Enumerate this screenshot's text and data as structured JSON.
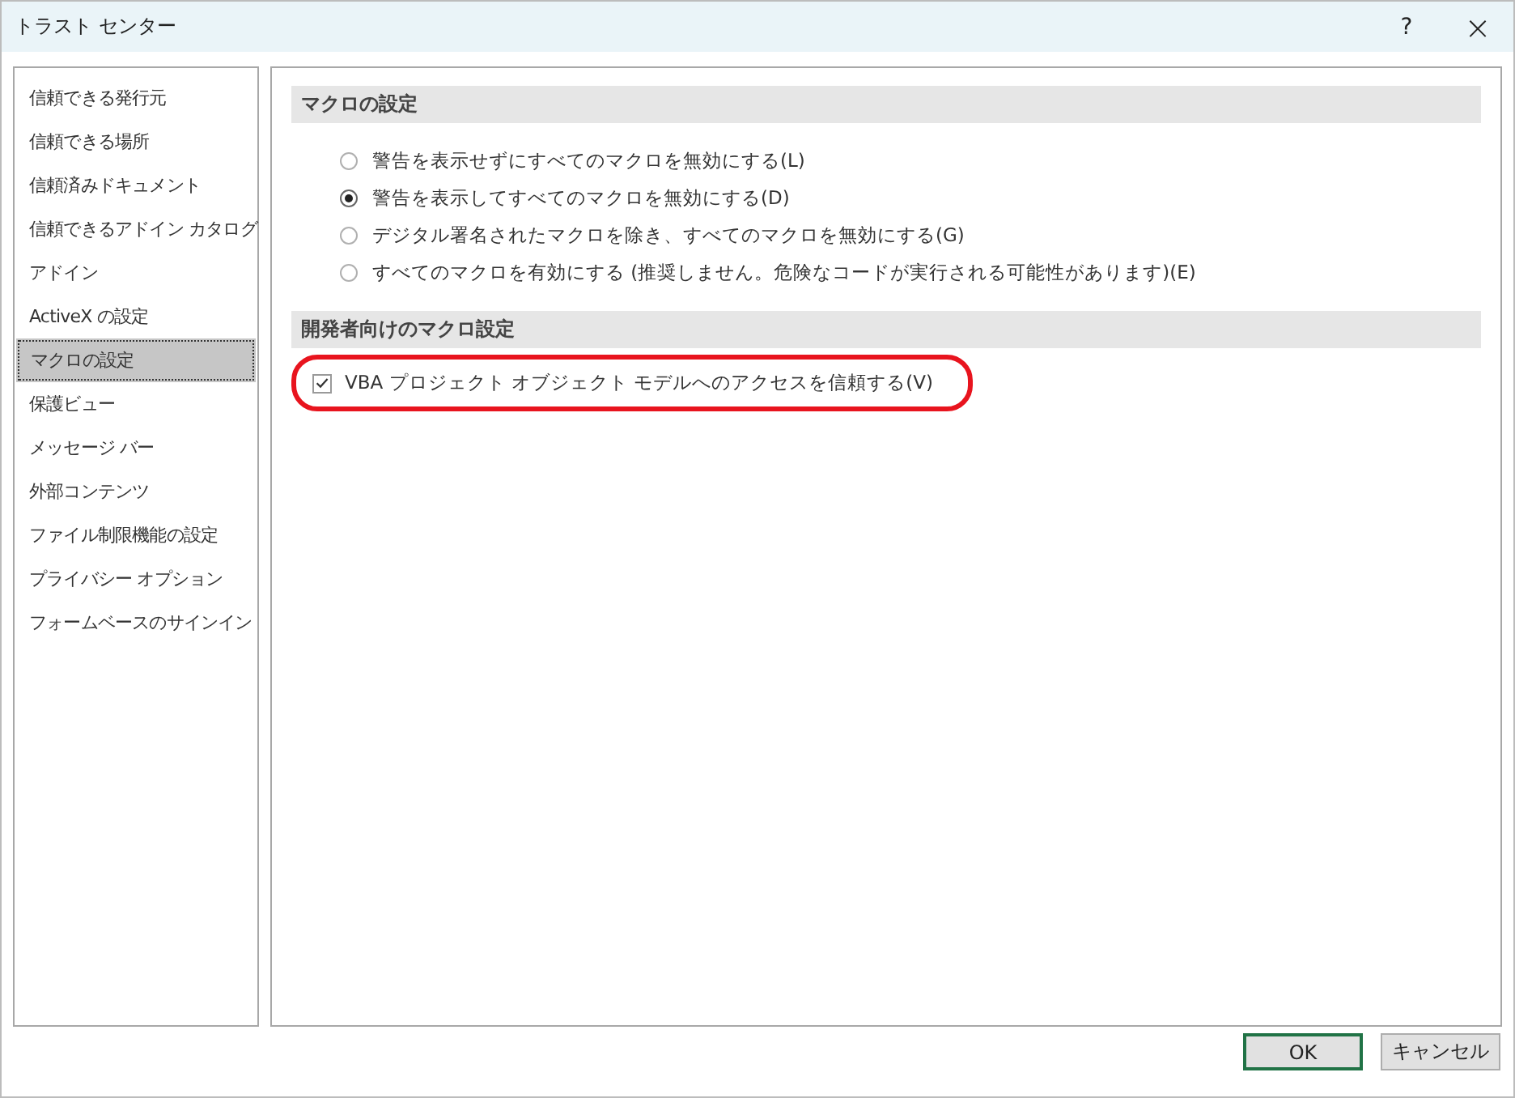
{
  "window": {
    "title": "トラスト センター",
    "help": "?",
    "close": "×"
  },
  "sidebar": {
    "items": [
      {
        "label": "信頼できる発行元",
        "selected": false
      },
      {
        "label": "信頼できる場所",
        "selected": false
      },
      {
        "label": "信頼済みドキュメント",
        "selected": false
      },
      {
        "label": "信頼できるアドイン カタログ",
        "selected": false
      },
      {
        "label": "アドイン",
        "selected": false
      },
      {
        "label": "ActiveX の設定",
        "selected": false
      },
      {
        "label": "マクロの設定",
        "selected": true
      },
      {
        "label": "保護ビュー",
        "selected": false
      },
      {
        "label": "メッセージ バー",
        "selected": false
      },
      {
        "label": "外部コンテンツ",
        "selected": false
      },
      {
        "label": "ファイル制限機能の設定",
        "selected": false
      },
      {
        "label": "プライバシー オプション",
        "selected": false
      },
      {
        "label": "フォームベースのサインイン",
        "selected": false
      }
    ]
  },
  "sections": [
    {
      "title": "マクロの設定",
      "kind": "radio",
      "options": [
        {
          "label": "警告を表示せずにすべてのマクロを無効にする(L)",
          "selected": false
        },
        {
          "label": "警告を表示してすべてのマクロを無効にする(D)",
          "selected": true
        },
        {
          "label": "デジタル署名されたマクロを除き、すべてのマクロを無効にする(G)",
          "selected": false
        },
        {
          "label": "すべてのマクロを有効にする (推奨しません。危険なコードが実行される可能性があります)(E)",
          "selected": false
        }
      ]
    },
    {
      "title": "開発者向けのマクロ設定",
      "kind": "checkbox",
      "highlighted": true,
      "options": [
        {
          "label": "VBA プロジェクト オブジェクト モデルへのアクセスを信頼する(V)",
          "checked": true
        }
      ]
    }
  ],
  "buttons": [
    {
      "label": "OK",
      "default": true
    },
    {
      "label": "キャンセル",
      "default": false
    }
  ]
}
